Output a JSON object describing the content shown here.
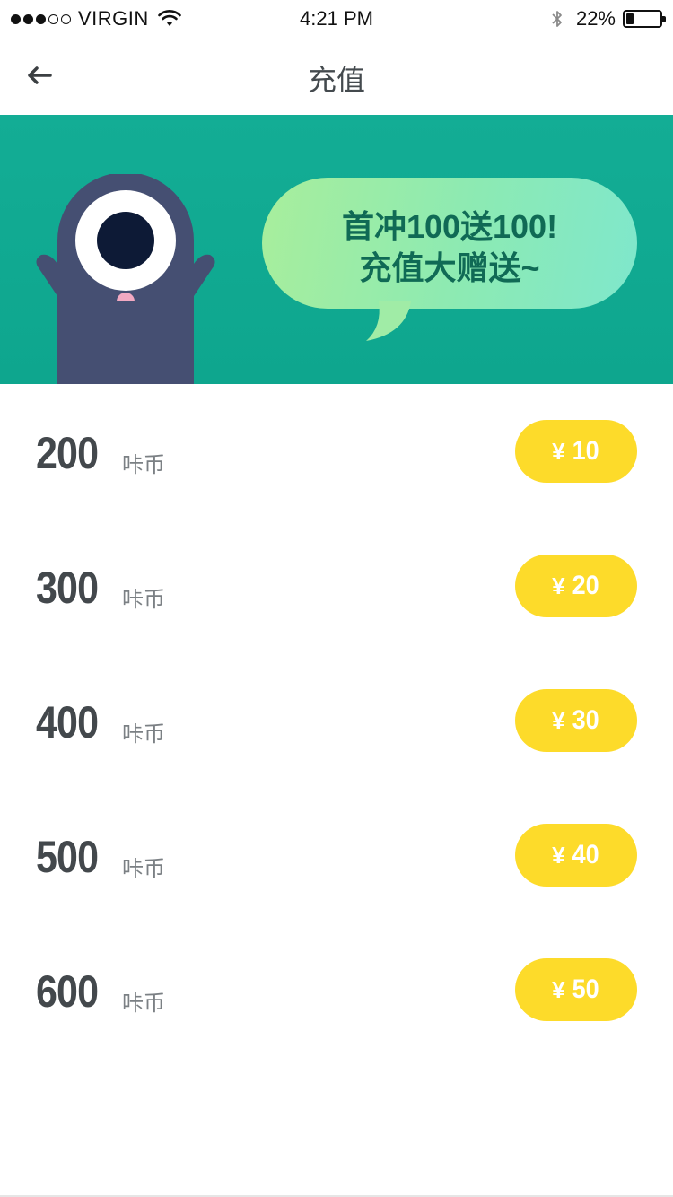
{
  "status_bar": {
    "carrier": "VIRGIN",
    "signal_bars_filled": 3,
    "signal_bars_total": 5,
    "time": "4:21 PM",
    "battery_percent_text": "22%",
    "battery_level": 0.22,
    "icons": [
      "wifi-icon",
      "bluetooth-icon",
      "battery-icon"
    ]
  },
  "nav": {
    "title": "充值",
    "back_icon": "arrow-left-icon"
  },
  "banner": {
    "line1": "首冲100送100!",
    "line2": "充值大赠送~",
    "mascot": "one-eyed-monster"
  },
  "recharge_options": [
    {
      "amount": "200",
      "unit": "咔币",
      "currency": "¥",
      "price": "10"
    },
    {
      "amount": "300",
      "unit": "咔币",
      "currency": "¥",
      "price": "20"
    },
    {
      "amount": "400",
      "unit": "咔币",
      "currency": "¥",
      "price": "30"
    },
    {
      "amount": "500",
      "unit": "咔币",
      "currency": "¥",
      "price": "40"
    },
    {
      "amount": "600",
      "unit": "咔币",
      "currency": "¥",
      "price": "50"
    }
  ],
  "colors": {
    "banner": "#13ad95",
    "bubble": "#a8ee9c",
    "bubble_text": "#106a55",
    "price_button": "#fddb2a",
    "monster_body": "#454f72",
    "text_primary": "#43484c"
  }
}
